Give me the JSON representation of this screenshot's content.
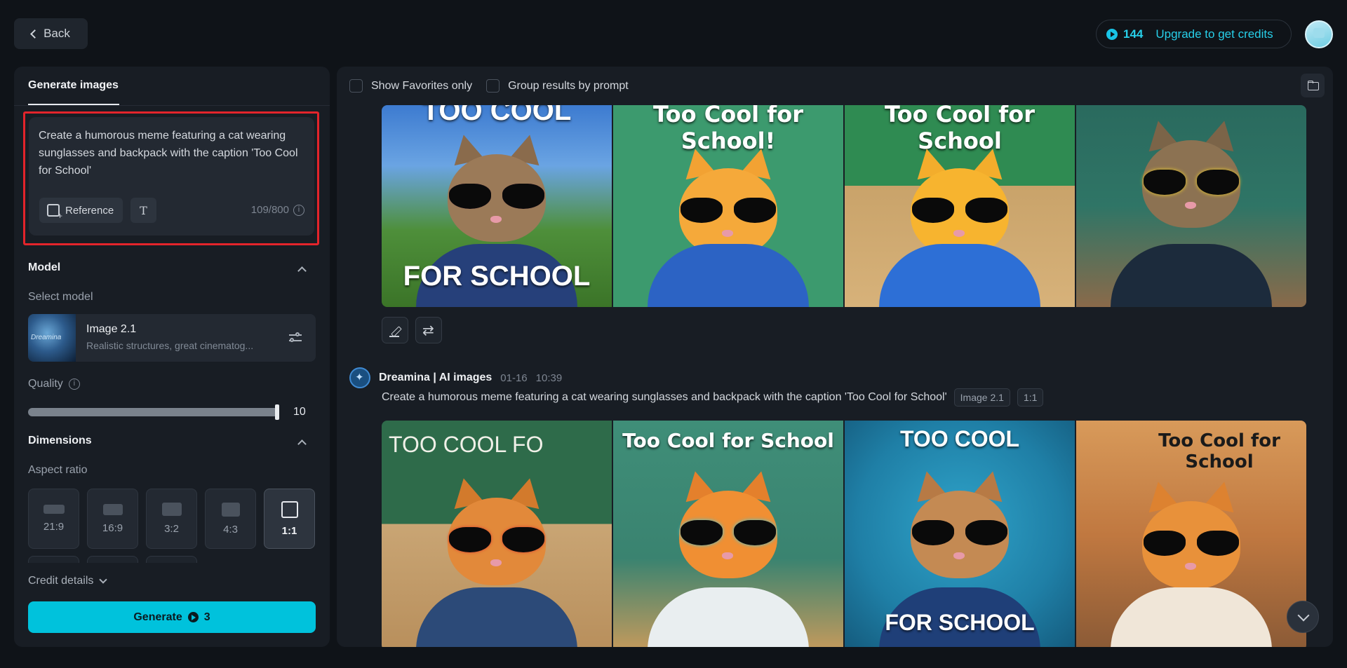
{
  "header": {
    "back_label": "Back",
    "credits": "144",
    "upgrade_label": "Upgrade to get credits"
  },
  "left_panel": {
    "tab_label": "Generate images",
    "prompt": {
      "text": "Create a humorous meme featuring a cat wearing sunglasses and backpack with the caption 'Too Cool for School'",
      "reference_label": "Reference",
      "text_tool_glyph": "T",
      "char_count": "109/800"
    },
    "model": {
      "section_title": "Model",
      "select_label": "Select model",
      "name": "Image 2.1",
      "description": "Realistic structures, great cinematog..."
    },
    "quality": {
      "label": "Quality",
      "value": "10",
      "level_fraction": 1.0
    },
    "dimensions": {
      "section_title": "Dimensions",
      "aspect_label": "Aspect ratio",
      "ratios": [
        "21:9",
        "16:9",
        "3:2",
        "4:3",
        "1:1"
      ],
      "selected": "1:1"
    },
    "credit_details_label": "Credit details",
    "generate": {
      "label": "Generate",
      "cost": "3"
    }
  },
  "right_panel": {
    "filters": {
      "favorites_label": "Show Favorites only",
      "group_label": "Group results by prompt"
    },
    "top_row_captions": [
      {
        "top": "TOO COOL",
        "bottom": "FOR SCHOOL"
      },
      {
        "top": "Too Cool for School!",
        "bottom": ""
      },
      {
        "top": "Too Cool for School",
        "bottom": ""
      },
      {
        "top": "",
        "bottom": ""
      }
    ],
    "generation": {
      "author": "Dreamina | AI images",
      "date": "01-16",
      "time": "10:39",
      "prompt": "Create a humorous meme featuring a cat wearing sunglasses and backpack with the caption 'Too Cool for School'",
      "model_tag": "Image 2.1",
      "ratio_tag": "1:1"
    },
    "bottom_row_captions": [
      {
        "top": "TOO COOL FO",
        "bottom": ""
      },
      {
        "top": "Too Cool for School",
        "bottom": ""
      },
      {
        "top": "TOO COOL",
        "bottom": "FOR SCHOOL"
      },
      {
        "top": "Too Cool for School",
        "bottom": ""
      }
    ]
  },
  "colors": {
    "accent": "#00c2dc",
    "highlight_box": "#e3242b"
  }
}
